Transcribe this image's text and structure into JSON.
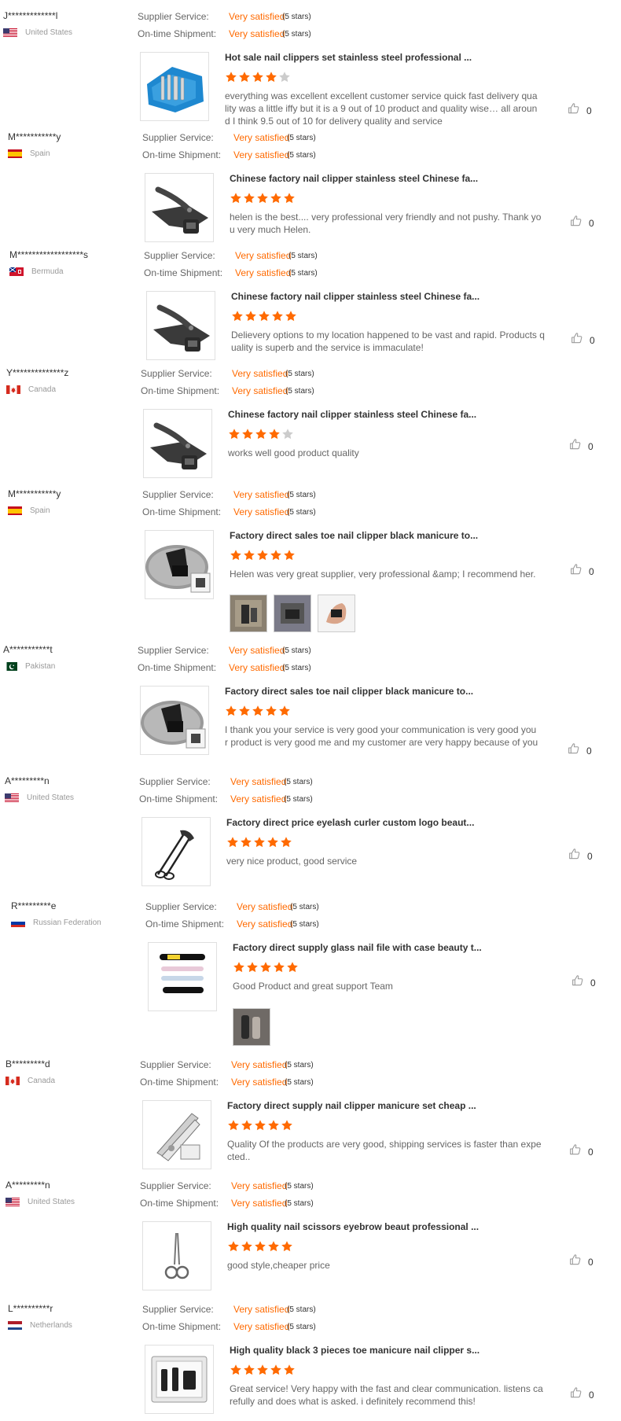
{
  "labels": {
    "supplier_service": "Supplier Service:",
    "on_time_shipment": "On-time Shipment:"
  },
  "colors": {
    "accent": "#ff6a00",
    "star_empty": "#cccccc"
  },
  "reviews": [
    {
      "buyer": "J*************l",
      "country": "United States",
      "flag": "us",
      "supplier_service": {
        "value": "Very satisfied",
        "stars": "(5 stars)"
      },
      "on_time_shipment": {
        "value": "Very satisfied",
        "stars": "(5 stars)"
      },
      "product_title": "Hot sale nail clippers set stainless steel professional ...",
      "product_image": "blue-manicure-case",
      "rating": 4,
      "comment": "everything was excellent excellent customer service quick fast delivery quality was a little iffy but it is a 9 out of 10 product and  quality wise… all around I think 9.5 out of 10 for delivery quality and service",
      "photos": [],
      "likes": "0"
    },
    {
      "buyer": "M***********y",
      "country": "Spain",
      "flag": "es",
      "supplier_service": {
        "value": "Very satisfied",
        "stars": "(5 stars)"
      },
      "on_time_shipment": {
        "value": "Very satisfied",
        "stars": "(5 stars)"
      },
      "product_title": "Chinese factory nail clipper stainless steel Chinese fa...",
      "product_image": "black-clipper",
      "rating": 5,
      "comment": "helen is the best.... very professional very friendly and not pushy. Thank you very much Helen.",
      "photos": [],
      "likes": "0"
    },
    {
      "buyer": "M******************s",
      "country": "Bermuda",
      "flag": "bm",
      "supplier_service": {
        "value": "Very satisfied",
        "stars": "(5 stars)"
      },
      "on_time_shipment": {
        "value": "Very satisfied",
        "stars": "(5 stars)"
      },
      "product_title": "Chinese factory nail clipper stainless steel Chinese fa...",
      "product_image": "black-clipper",
      "rating": 5,
      "comment": "Delievery options to my location happened to be vast and rapid. Products quality is superb and the service is immaculate!",
      "photos": [],
      "likes": "0"
    },
    {
      "buyer": "Y**************z",
      "country": "Canada",
      "flag": "ca",
      "supplier_service": {
        "value": "Very satisfied",
        "stars": "(5 stars)"
      },
      "on_time_shipment": {
        "value": "Very satisfied",
        "stars": "(5 stars)"
      },
      "product_title": "Chinese factory nail clipper stainless steel Chinese fa...",
      "product_image": "black-clipper",
      "rating": 4,
      "comment": "works well good product quality",
      "photos": [],
      "likes": "0"
    },
    {
      "buyer": "M***********y",
      "country": "Spain",
      "flag": "es",
      "supplier_service": {
        "value": "Very satisfied",
        "stars": "(5 stars)"
      },
      "on_time_shipment": {
        "value": "Very satisfied",
        "stars": "(5 stars)"
      },
      "product_title": "Factory direct sales toe nail clipper black manicure to...",
      "product_image": "toe-clipper",
      "rating": 5,
      "comment": "Helen was very great supplier, very professional &amp; I recommend her.",
      "photos": [
        "photo-clipper-box",
        "photo-clipper-dark",
        "photo-hand-clipper"
      ],
      "likes": "0"
    },
    {
      "buyer": "A***********t",
      "country": "Pakistan",
      "flag": "pk",
      "supplier_service": {
        "value": "Very satisfied",
        "stars": "(5 stars)"
      },
      "on_time_shipment": {
        "value": "Very satisfied",
        "stars": "(5 stars)"
      },
      "product_title": "Factory direct sales toe nail clipper black manicure to...",
      "product_image": "toe-clipper",
      "rating": 5,
      "comment": "I thank you your service is very good your communication is very good your product is very good me and my customer are very happy because of you",
      "photos": [],
      "likes": "0"
    },
    {
      "buyer": "A*********n",
      "country": "United States",
      "flag": "us",
      "supplier_service": {
        "value": "Very satisfied",
        "stars": "(5 stars)"
      },
      "on_time_shipment": {
        "value": "Very satisfied",
        "stars": "(5 stars)"
      },
      "product_title": "Factory direct price eyelash curler custom logo beaut...",
      "product_image": "eyelash-curler",
      "rating": 5,
      "comment": "very nice product, good service",
      "photos": [],
      "likes": "0"
    },
    {
      "buyer": "R*********e",
      "country": "Russian Federation",
      "flag": "ru",
      "supplier_service": {
        "value": "Very satisfied",
        "stars": "(5 stars)"
      },
      "on_time_shipment": {
        "value": "Very satisfied",
        "stars": "(5 stars)"
      },
      "product_title": "Factory direct supply glass nail file with case beauty t...",
      "product_image": "glass-nail-files",
      "rating": 5,
      "comment": "Good Product and great support Team",
      "photos": [
        "photo-nail-file"
      ],
      "likes": "0"
    },
    {
      "buyer": "B*********d",
      "country": "Canada",
      "flag": "ca",
      "supplier_service": {
        "value": "Very satisfied",
        "stars": "(5 stars)"
      },
      "on_time_shipment": {
        "value": "Very satisfied",
        "stars": "(5 stars)"
      },
      "product_title": "Factory direct supply nail clipper manicure set cheap ...",
      "product_image": "silver-clipper",
      "rating": 5,
      "comment": "Quality Of the products are very good, shipping services is faster than expected..",
      "photos": [],
      "likes": "0"
    },
    {
      "buyer": "A*********n",
      "country": "United States",
      "flag": "us",
      "supplier_service": {
        "value": "Very satisfied",
        "stars": "(5 stars)"
      },
      "on_time_shipment": {
        "value": "Very satisfied",
        "stars": "(5 stars)"
      },
      "product_title": "High quality nail scissors eyebrow beaut professional ...",
      "product_image": "nail-scissors",
      "rating": 5,
      "comment": "good style,cheaper price",
      "photos": [],
      "likes": "0"
    },
    {
      "buyer": "L**********r",
      "country": "Netherlands",
      "flag": "nl",
      "supplier_service": {
        "value": "Very satisfied",
        "stars": "(5 stars)"
      },
      "on_time_shipment": {
        "value": "Very satisfied",
        "stars": "(5 stars)"
      },
      "product_title": "High quality black 3 pieces toe manicure nail clipper s...",
      "product_image": "clipper-gift-box",
      "rating": 5,
      "comment": "Great service! Very happy with the fast and clear communication. listens carefully and does what is asked. i definitely recommend this!",
      "photos": [],
      "likes": "0"
    }
  ]
}
